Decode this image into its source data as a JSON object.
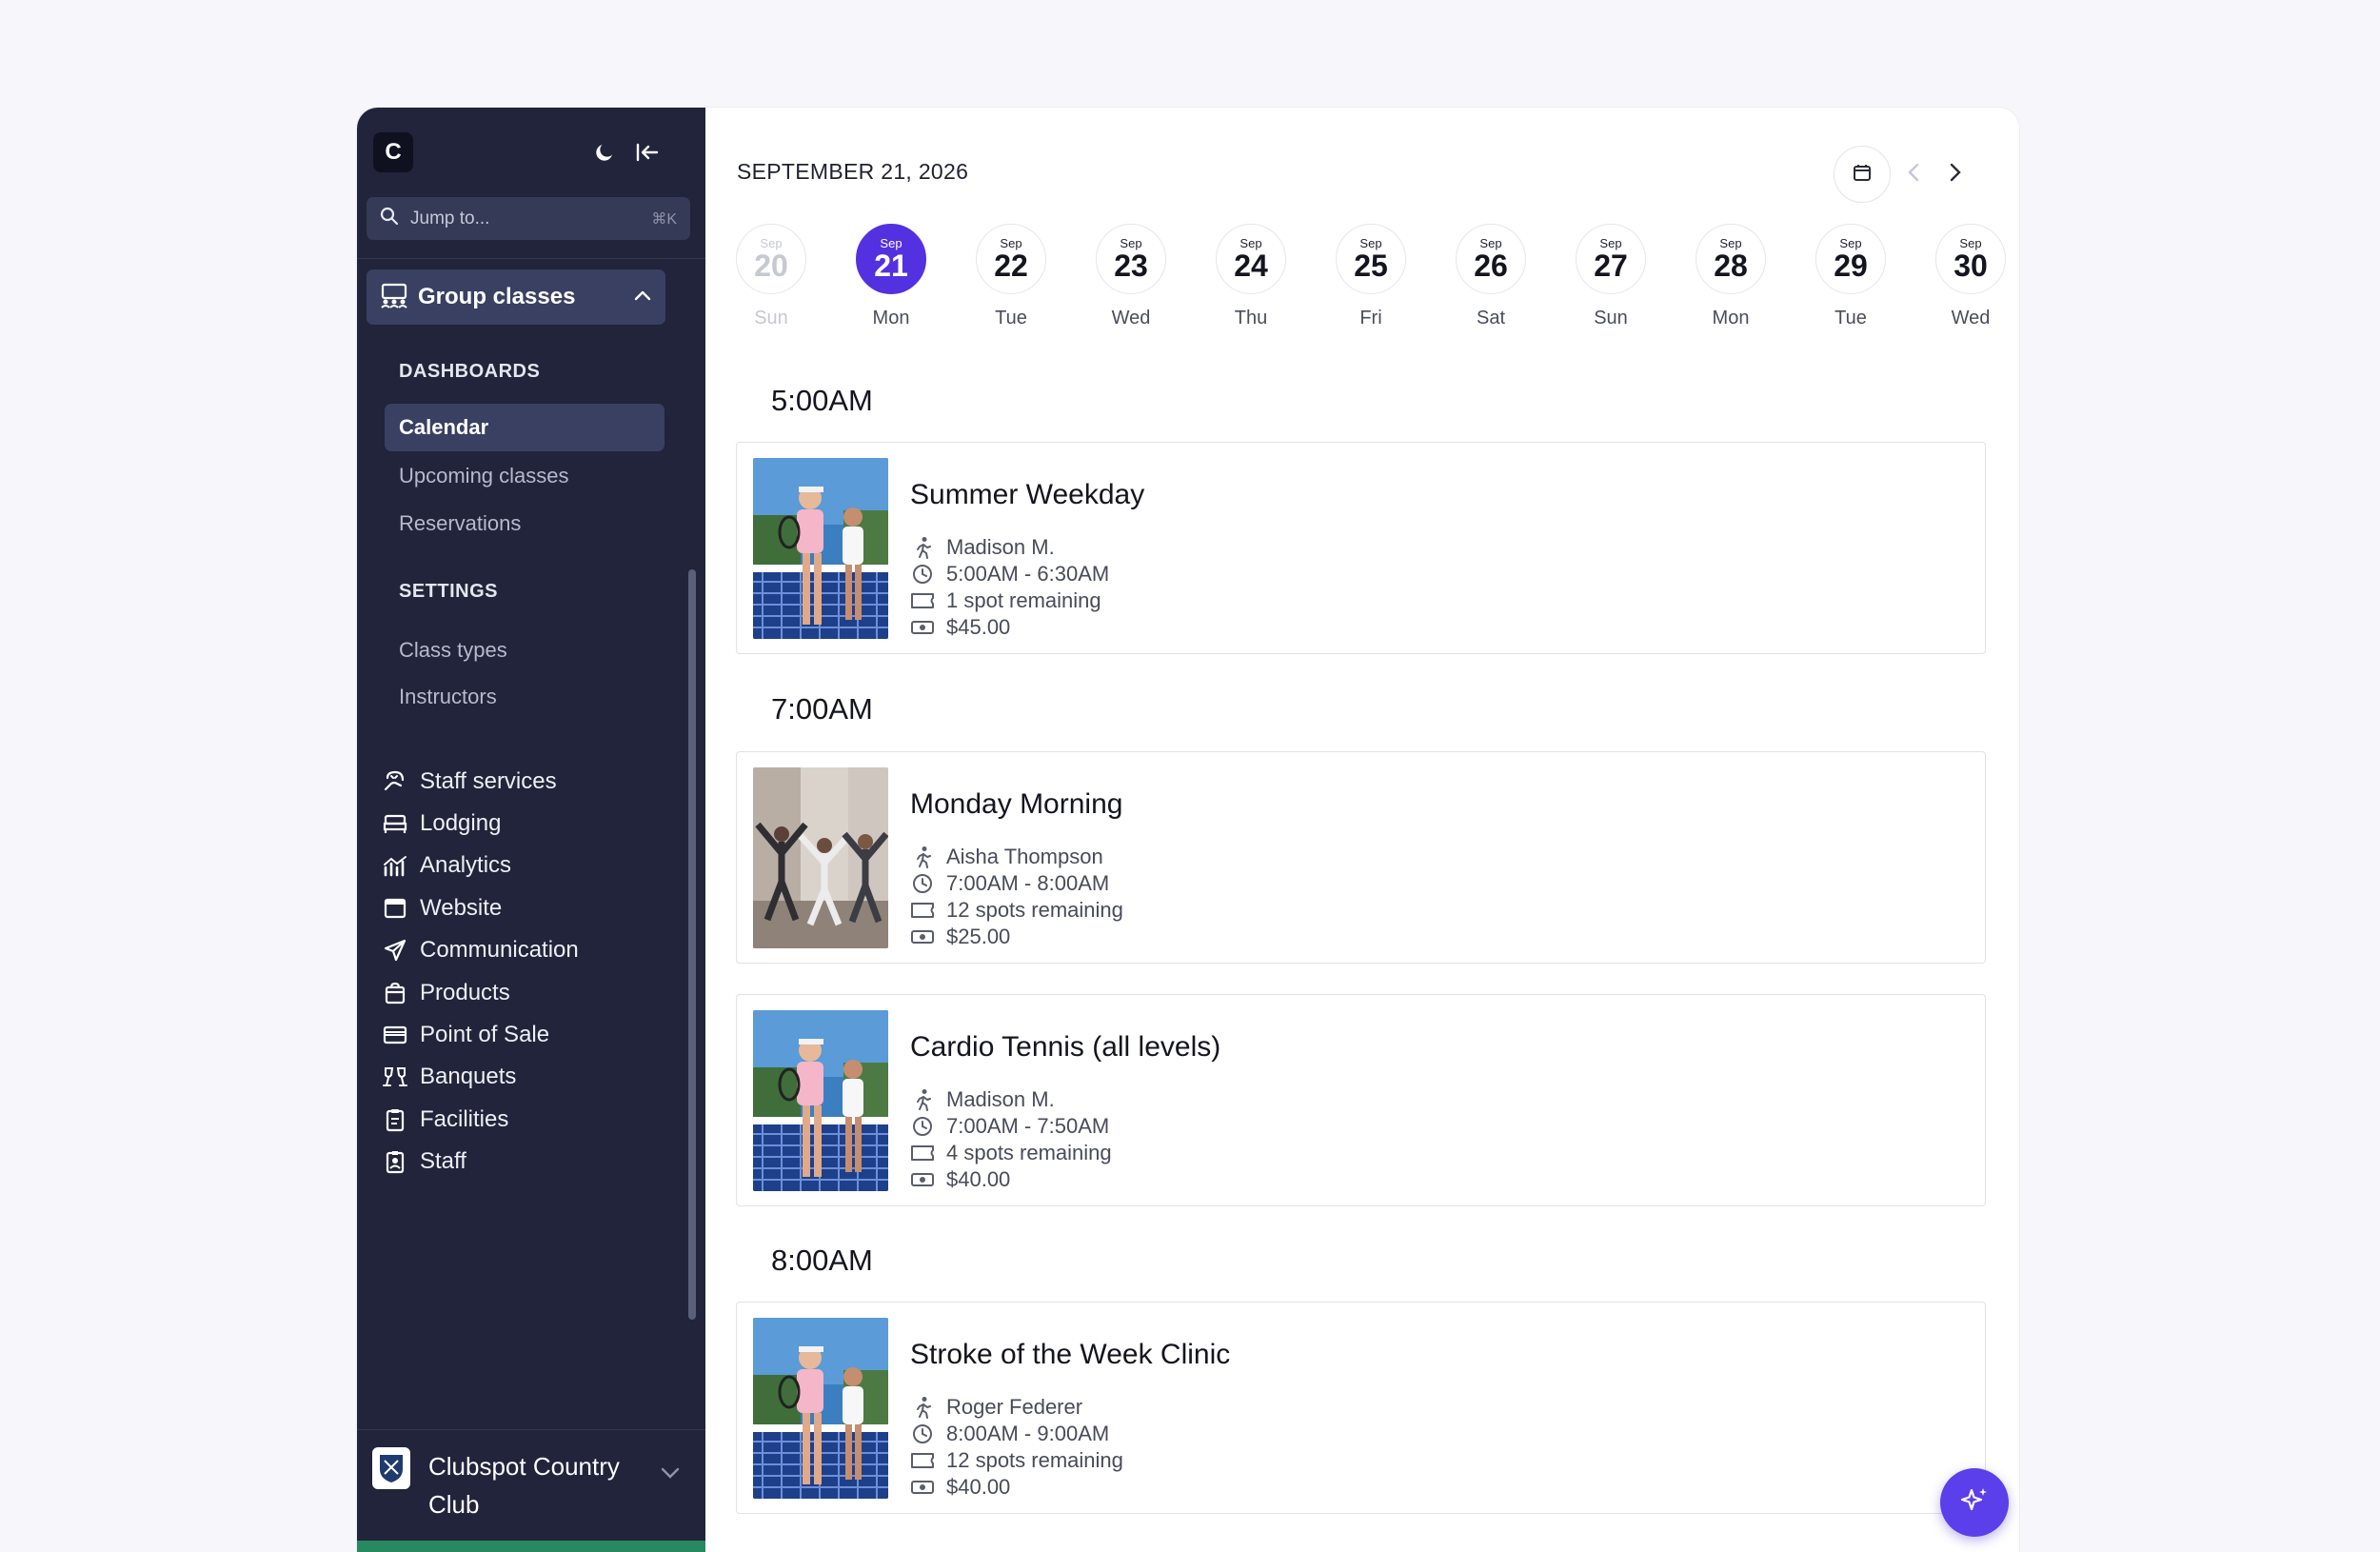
{
  "sidebar": {
    "logo_letter": "C",
    "search": {
      "placeholder": "Jump to...",
      "shortcut": "⌘K"
    },
    "group": {
      "label": "Group classes"
    },
    "dashboards_header": "DASHBOARDS",
    "dashboards": [
      "Calendar",
      "Upcoming classes",
      "Reservations"
    ],
    "settings_header": "SETTINGS",
    "settings": [
      "Class types",
      "Instructors"
    ],
    "nav": [
      {
        "label": "Staff services",
        "icon": "hand-icon"
      },
      {
        "label": "Lodging",
        "icon": "bed-icon"
      },
      {
        "label": "Analytics",
        "icon": "analytics-icon"
      },
      {
        "label": "Website",
        "icon": "browser-icon"
      },
      {
        "label": "Communication",
        "icon": "paper-plane-icon"
      },
      {
        "label": "Products",
        "icon": "bag-icon"
      },
      {
        "label": "Point of Sale",
        "icon": "credit-card-icon"
      },
      {
        "label": "Banquets",
        "icon": "glasses-icon"
      },
      {
        "label": "Facilities",
        "icon": "clipboard-icon"
      },
      {
        "label": "Staff",
        "icon": "badge-icon"
      }
    ],
    "club_name": "Clubspot Country Club"
  },
  "header": {
    "date": "SEPTEMBER 21, 2026"
  },
  "days": [
    {
      "month": "Sep",
      "day": "20",
      "weekday": "Sun",
      "state": "past"
    },
    {
      "month": "Sep",
      "day": "21",
      "weekday": "Mon",
      "state": "active"
    },
    {
      "month": "Sep",
      "day": "22",
      "weekday": "Tue",
      "state": ""
    },
    {
      "month": "Sep",
      "day": "23",
      "weekday": "Wed",
      "state": ""
    },
    {
      "month": "Sep",
      "day": "24",
      "weekday": "Thu",
      "state": ""
    },
    {
      "month": "Sep",
      "day": "25",
      "weekday": "Fri",
      "state": ""
    },
    {
      "month": "Sep",
      "day": "26",
      "weekday": "Sat",
      "state": ""
    },
    {
      "month": "Sep",
      "day": "27",
      "weekday": "Sun",
      "state": ""
    },
    {
      "month": "Sep",
      "day": "28",
      "weekday": "Mon",
      "state": ""
    },
    {
      "month": "Sep",
      "day": "29",
      "weekday": "Tue",
      "state": ""
    },
    {
      "month": "Sep",
      "day": "30",
      "weekday": "Wed",
      "state": ""
    }
  ],
  "time_slots": [
    "5:00AM",
    "7:00AM",
    "8:00AM"
  ],
  "classes": [
    {
      "title": "Summer Weekday",
      "instructor": "Madison M.",
      "time": "5:00AM - 6:30AM",
      "spots": "1 spot remaining",
      "price": "$45.00",
      "image": "tennis"
    },
    {
      "title": "Monday Morning",
      "instructor": "Aisha Thompson",
      "time": "7:00AM - 8:00AM",
      "spots": "12 spots remaining",
      "price": "$25.00",
      "image": "yoga"
    },
    {
      "title": "Cardio Tennis (all levels)",
      "instructor": "Madison M.",
      "time": "7:00AM - 7:50AM",
      "spots": "4 spots remaining",
      "price": "$40.00",
      "image": "tennis"
    },
    {
      "title": "Stroke of the Week Clinic",
      "instructor": "Roger Federer",
      "time": "8:00AM - 9:00AM",
      "spots": "12 spots remaining",
      "price": "$40.00",
      "image": "tennis"
    }
  ],
  "colors": {
    "accent": "#5431e0",
    "sidebar_bg": "#21243a",
    "fab": "#5b3fea"
  }
}
